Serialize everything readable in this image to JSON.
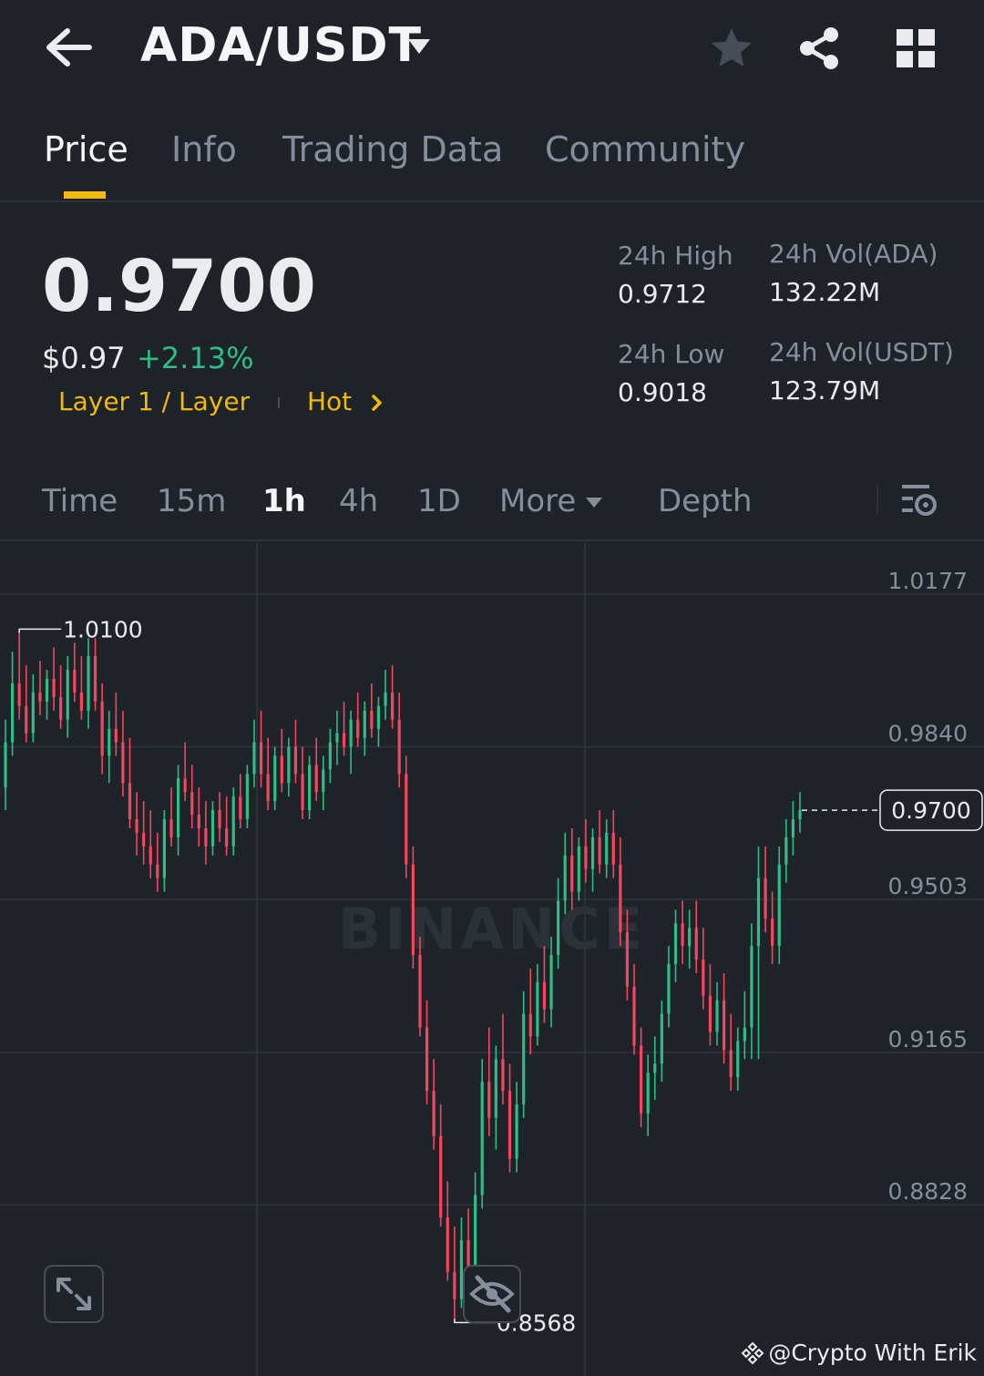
{
  "header": {
    "pair": "ADA/USDT",
    "icons": [
      "back-arrow-icon",
      "caret-down-icon",
      "star-icon",
      "share-icon",
      "grid-icon"
    ]
  },
  "tabs": [
    {
      "label": "Price",
      "active": true
    },
    {
      "label": "Info",
      "active": false
    },
    {
      "label": "Trading Data",
      "active": false
    },
    {
      "label": "Community",
      "active": false
    }
  ],
  "price": {
    "last": "0.9700",
    "usd": "$0.97",
    "change": "+2.13%",
    "tag_category": "Layer 1 / Layer",
    "tag_hot": "Hot"
  },
  "stats": {
    "high_label": "24h High",
    "high_value": "0.9712",
    "low_label": "24h Low",
    "low_value": "0.9018",
    "vol_base_label": "24h Vol(ADA)",
    "vol_base_value": "132.22M",
    "vol_quote_label": "24h Vol(USDT)",
    "vol_quote_value": "123.79M"
  },
  "timeframes": {
    "time": "Time",
    "m15": "15m",
    "h1": "1h",
    "h4": "4h",
    "d1": "1D",
    "more": "More",
    "depth": "Depth",
    "active": "1h"
  },
  "colors": {
    "bg": "#1e2329",
    "up": "#2ebd85",
    "down": "#f6465d",
    "accent": "#f0b90b",
    "muted": "#848e9c"
  },
  "chart_data": {
    "type": "candlestick",
    "interval": "1h",
    "y_ticks": [
      "1.0177",
      "0.9840",
      "0.9503",
      "0.9165",
      "0.8828"
    ],
    "ylim": [
      0.845,
      1.029
    ],
    "grid": true,
    "max_marker": {
      "value": 1.01,
      "label": "1.0100"
    },
    "min_marker": {
      "value": 0.8568,
      "label": "0.8568"
    },
    "last_price_label": "0.9700",
    "last_price": 0.97,
    "watermark": "BINANCE",
    "candles": [
      [
        0.975,
        0.99,
        0.97,
        0.985
      ],
      [
        0.985,
        1.005,
        0.982,
        0.998
      ],
      [
        0.998,
        1.01,
        0.99,
        0.993
      ],
      [
        0.993,
        1.002,
        0.985,
        0.987
      ],
      [
        0.987,
        1.0,
        0.985,
        0.996
      ],
      [
        0.996,
        1.003,
        0.991,
        0.994
      ],
      [
        0.994,
        1.001,
        0.99,
        0.999
      ],
      [
        0.999,
        1.006,
        0.992,
        0.995
      ],
      [
        0.995,
        1.002,
        0.988,
        0.99
      ],
      [
        0.99,
        1.004,
        0.986,
        1.001
      ],
      [
        1.001,
        1.007,
        0.994,
        0.996
      ],
      [
        0.996,
        1.004,
        0.99,
        0.992
      ],
      [
        0.992,
        1.008,
        0.988,
        1.004
      ],
      [
        1.004,
        1.008,
        0.992,
        0.994
      ],
      [
        0.994,
        0.998,
        0.978,
        0.982
      ],
      [
        0.982,
        0.992,
        0.976,
        0.988
      ],
      [
        0.988,
        0.996,
        0.982,
        0.985
      ],
      [
        0.985,
        0.992,
        0.973,
        0.976
      ],
      [
        0.976,
        0.986,
        0.966,
        0.968
      ],
      [
        0.968,
        0.974,
        0.96,
        0.965
      ],
      [
        0.965,
        0.972,
        0.958,
        0.962
      ],
      [
        0.962,
        0.97,
        0.955,
        0.958
      ],
      [
        0.958,
        0.965,
        0.952,
        0.955
      ],
      [
        0.955,
        0.97,
        0.952,
        0.968
      ],
      [
        0.968,
        0.975,
        0.962,
        0.964
      ],
      [
        0.964,
        0.98,
        0.96,
        0.977
      ],
      [
        0.977,
        0.985,
        0.972,
        0.974
      ],
      [
        0.974,
        0.98,
        0.966,
        0.969
      ],
      [
        0.969,
        0.975,
        0.962,
        0.966
      ],
      [
        0.966,
        0.972,
        0.958,
        0.962
      ],
      [
        0.962,
        0.972,
        0.96,
        0.97
      ],
      [
        0.97,
        0.974,
        0.963,
        0.966
      ],
      [
        0.966,
        0.973,
        0.96,
        0.962
      ],
      [
        0.962,
        0.975,
        0.96,
        0.973
      ],
      [
        0.973,
        0.978,
        0.966,
        0.968
      ],
      [
        0.968,
        0.98,
        0.966,
        0.978
      ],
      [
        0.978,
        0.99,
        0.975,
        0.985
      ],
      [
        0.985,
        0.992,
        0.975,
        0.978
      ],
      [
        0.978,
        0.986,
        0.97,
        0.972
      ],
      [
        0.972,
        0.984,
        0.97,
        0.982
      ],
      [
        0.982,
        0.988,
        0.974,
        0.976
      ],
      [
        0.976,
        0.986,
        0.973,
        0.984
      ],
      [
        0.984,
        0.99,
        0.976,
        0.978
      ],
      [
        0.978,
        0.984,
        0.968,
        0.97
      ],
      [
        0.97,
        0.982,
        0.968,
        0.98
      ],
      [
        0.98,
        0.986,
        0.972,
        0.974
      ],
      [
        0.974,
        0.982,
        0.97,
        0.979
      ],
      [
        0.979,
        0.988,
        0.976,
        0.985
      ],
      [
        0.985,
        0.992,
        0.98,
        0.987
      ],
      [
        0.987,
        0.994,
        0.982,
        0.984
      ],
      [
        0.984,
        0.992,
        0.978,
        0.99
      ],
      [
        0.99,
        0.996,
        0.984,
        0.986
      ],
      [
        0.986,
        0.994,
        0.982,
        0.992
      ],
      [
        0.992,
        0.998,
        0.986,
        0.988
      ],
      [
        0.988,
        0.995,
        0.984,
        0.993
      ],
      [
        0.993,
        1.001,
        0.99,
        0.996
      ],
      [
        0.996,
        1.002,
        0.988,
        0.99
      ],
      [
        0.99,
        0.996,
        0.975,
        0.978
      ],
      [
        0.978,
        0.982,
        0.955,
        0.958
      ],
      [
        0.958,
        0.962,
        0.935,
        0.938
      ],
      [
        0.938,
        0.942,
        0.92,
        0.922
      ],
      [
        0.922,
        0.928,
        0.905,
        0.908
      ],
      [
        0.908,
        0.915,
        0.895,
        0.898
      ],
      [
        0.898,
        0.905,
        0.878,
        0.88
      ],
      [
        0.88,
        0.888,
        0.866,
        0.868
      ],
      [
        0.868,
        0.878,
        0.857,
        0.862
      ],
      [
        0.862,
        0.88,
        0.86,
        0.875
      ],
      [
        0.875,
        0.882,
        0.865,
        0.868
      ],
      [
        0.868,
        0.89,
        0.866,
        0.885
      ],
      [
        0.885,
        0.915,
        0.882,
        0.91
      ],
      [
        0.91,
        0.922,
        0.898,
        0.902
      ],
      [
        0.902,
        0.918,
        0.895,
        0.915
      ],
      [
        0.915,
        0.925,
        0.905,
        0.908
      ],
      [
        0.908,
        0.914,
        0.89,
        0.893
      ],
      [
        0.893,
        0.91,
        0.89,
        0.905
      ],
      [
        0.905,
        0.93,
        0.902,
        0.925
      ],
      [
        0.925,
        0.935,
        0.916,
        0.92
      ],
      [
        0.92,
        0.936,
        0.918,
        0.932
      ],
      [
        0.932,
        0.94,
        0.923,
        0.926
      ],
      [
        0.926,
        0.942,
        0.922,
        0.938
      ],
      [
        0.938,
        0.955,
        0.935,
        0.95
      ],
      [
        0.95,
        0.965,
        0.947,
        0.96
      ],
      [
        0.96,
        0.966,
        0.948,
        0.952
      ],
      [
        0.952,
        0.964,
        0.95,
        0.962
      ],
      [
        0.962,
        0.968,
        0.954,
        0.957
      ],
      [
        0.957,
        0.966,
        0.952,
        0.964
      ],
      [
        0.964,
        0.97,
        0.956,
        0.958
      ],
      [
        0.958,
        0.968,
        0.955,
        0.965
      ],
      [
        0.965,
        0.97,
        0.955,
        0.958
      ],
      [
        0.958,
        0.964,
        0.94,
        0.943
      ],
      [
        0.943,
        0.948,
        0.928,
        0.931
      ],
      [
        0.931,
        0.936,
        0.916,
        0.918
      ],
      [
        0.918,
        0.922,
        0.9,
        0.903
      ],
      [
        0.903,
        0.916,
        0.898,
        0.912
      ],
      [
        0.912,
        0.92,
        0.906,
        0.914
      ],
      [
        0.914,
        0.928,
        0.91,
        0.925
      ],
      [
        0.925,
        0.94,
        0.922,
        0.936
      ],
      [
        0.936,
        0.948,
        0.932,
        0.945
      ],
      [
        0.945,
        0.95,
        0.936,
        0.94
      ],
      [
        0.94,
        0.948,
        0.935,
        0.944
      ],
      [
        0.944,
        0.95,
        0.934,
        0.937
      ],
      [
        0.937,
        0.944,
        0.926,
        0.929
      ],
      [
        0.929,
        0.936,
        0.918,
        0.921
      ],
      [
        0.921,
        0.932,
        0.918,
        0.928
      ],
      [
        0.928,
        0.934,
        0.914,
        0.917
      ],
      [
        0.917,
        0.925,
        0.908,
        0.911
      ],
      [
        0.911,
        0.922,
        0.908,
        0.919
      ],
      [
        0.919,
        0.93,
        0.915,
        0.922
      ],
      [
        0.922,
        0.945,
        0.915,
        0.94
      ],
      [
        0.94,
        0.962,
        0.915,
        0.955
      ],
      [
        0.955,
        0.962,
        0.943,
        0.946
      ],
      [
        0.946,
        0.952,
        0.936,
        0.94
      ],
      [
        0.94,
        0.962,
        0.936,
        0.958
      ],
      [
        0.958,
        0.968,
        0.954,
        0.964
      ],
      [
        0.964,
        0.972,
        0.96,
        0.968
      ],
      [
        0.968,
        0.974,
        0.965,
        0.97
      ]
    ]
  },
  "credit": "@Crypto With Erik"
}
